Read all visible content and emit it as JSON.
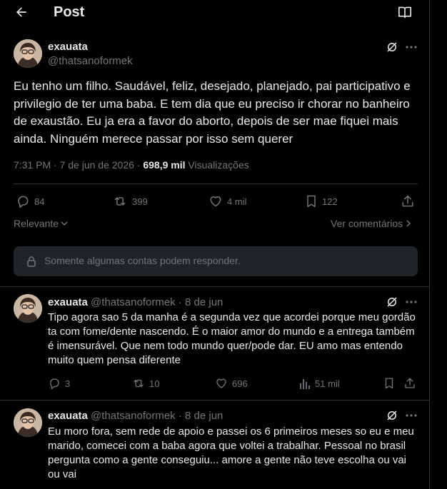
{
  "header": {
    "title": "Post"
  },
  "post": {
    "name": "exauata",
    "handle": "@thatsanoformek",
    "text": "Eu tenho um filho. Saudável, feliz, desejado, planejado, pai participativo e privilegio de ter uma baba. E tem dia que eu preciso ir chorar no banheiro de exaustão. Eu ja era a favor do aborto, depois de ser mae fiquei mais ainda. Ninguém merece passar por isso sem querer",
    "time": "7:31 PM · 7 de jun de 2026 · ",
    "views_count": "698,9 mil",
    "views_label": " Visualizações",
    "replies": "84",
    "reposts": "399",
    "likes": "4 mil",
    "bookmarks": "122"
  },
  "sort": {
    "relevant_label": "Relevante",
    "view_comments_label": "Ver comentários"
  },
  "reply_restriction": "Somente algumas contas podem responder.",
  "replies": [
    {
      "name": "exauata",
      "handle": "@thatsanoformek",
      "date": "· 8 de jun",
      "text": "Tipo agora sao 5 da manha é a segunda vez que acordei porque meu gordão ta com fome/dente nascendo. É o maior amor do mundo e a entrega também é imensurável. Que nem todo mundo quer/pode dar. EU amo mas entendo muito quem pensa diferente",
      "replies": "3",
      "reposts": "10",
      "likes": "696",
      "views": "51 mil"
    },
    {
      "name": "exauata",
      "handle": "@thatsanoformek",
      "date": "· 8 de jun",
      "text": "Eu moro fora, sem rede de apoio e passei os 6 primeiros meses so eu e meu marido, comecei com a baba agora que voltei a trabalhar. Pessoal no brasil pergunta como a gente conseguiu... amore a gente não teve escolha ou vai ou vai"
    }
  ]
}
